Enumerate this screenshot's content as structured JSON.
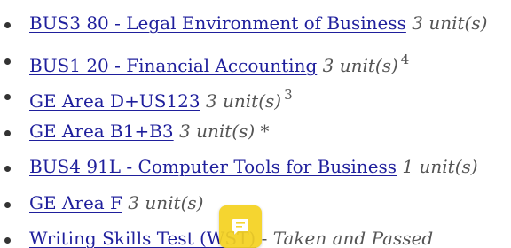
{
  "courses": [
    {
      "link": "BUS3 80 - Legal Environment of Business",
      "units": "3 unit(s)",
      "note": ""
    },
    {
      "link": "BUS1 20 - Financial Accounting",
      "units": "3 unit(s)",
      "note": "4"
    },
    {
      "link": "GE Area D+US123",
      "units": "3 unit(s)",
      "note": "3"
    },
    {
      "link": "GE Area B1+B3",
      "units": "3 unit(s)",
      "note": "*"
    },
    {
      "link": "BUS4 91L - Computer Tools for Business",
      "units": "1 unit(s)",
      "note": ""
    },
    {
      "link": "GE Area F",
      "units": "3 unit(s)",
      "note": ""
    },
    {
      "link": "Writing Skills Test (WST)",
      "separator": "-",
      "status": "Taken and Passed"
    }
  ],
  "widget": {
    "icon": "chat-icon",
    "color": "#f5d21f"
  }
}
